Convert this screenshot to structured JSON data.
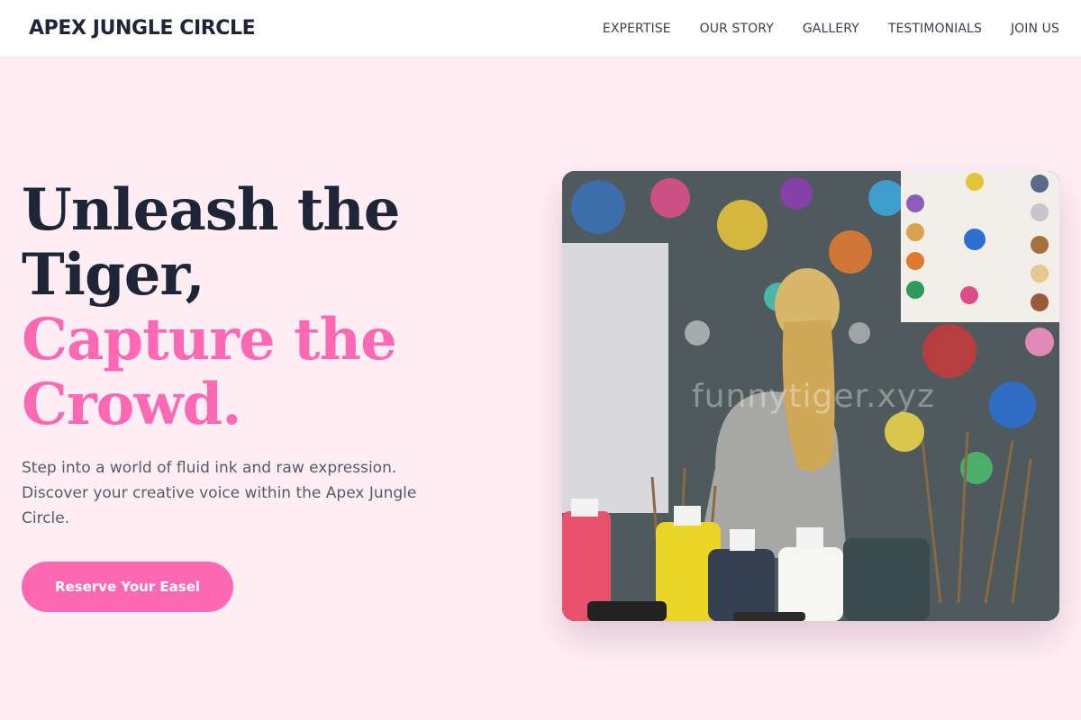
{
  "header": {
    "brand": "APEX JUNGLE CIRCLE",
    "nav": [
      {
        "label": "EXPERTISE"
      },
      {
        "label": "OUR STORY"
      },
      {
        "label": "GALLERY"
      },
      {
        "label": "TESTIMONIALS"
      },
      {
        "label": "JOIN US"
      }
    ]
  },
  "hero": {
    "headline_line1": "Unleash the",
    "headline_line2": "Tiger,",
    "headline_line3": "Capture the",
    "headline_line4": "Crowd.",
    "subtitle": "Step into a world of fluid ink and raw expression. Discover your creative voice within the Apex Jungle Circle.",
    "cta_label": "Reserve Your Easel"
  },
  "image": {
    "watermark": "funnytiger.xyz"
  },
  "colors": {
    "accent": "#ff69b4",
    "dark": "#1e2536",
    "background": "#ffeff5"
  }
}
